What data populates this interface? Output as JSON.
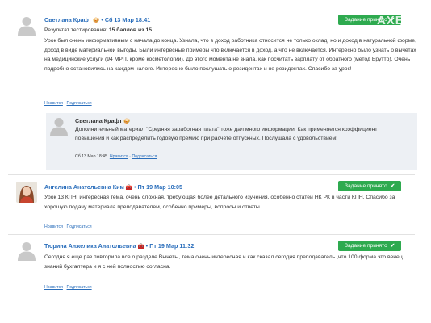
{
  "comments": [
    {
      "author": "Светлана Крафт",
      "author_emoji": "🥪",
      "date": "Сб 13 Мар 18:41",
      "badge": "Задание принято",
      "watermark": "AXEJA",
      "result_prefix": "Результат тестирования: ",
      "result_value": "15 баллов из 15",
      "text": "Урок был очень информативным с начала до конца. Узнала, что в доход работника относится не только оклад, но и доход в натуральной форме, доход в виде материальной выгоды. Были интересные примеры что включается в доход, а что не включается. Интересно было узнать о вычетах на медицинские услуги (94 МРП, кроме косметологии). До этого момента не знала, как посчитать зарплату от обратного (метод Брутто). Очень подробно остановились на каждом налоге. Интересно было послушать о резидентах и не резидентах. Спасибо за урок!",
      "like": "Нравится",
      "subscribe": "Подписаться",
      "reply": {
        "author": "Светлана Крафт",
        "author_emoji": "🥪",
        "text": "Дополнительный материал \"Средняя заработная плата\" тоже дал много информации. Как применяется коэффициент повышения и как распределить годовую премию при расчете отпускных. Послушала с удовольствием!",
        "date": "Сб 13 Мар 18:45",
        "like": "Нравится",
        "subscribe": "Подписаться"
      }
    },
    {
      "author": "Ангелина Анатольевна Ким",
      "author_emoji": "🧰",
      "date": "Пт 19 Мар 10:05",
      "badge": "Задание принято",
      "text": "Урок 13 КПН, интересная тема, очень сложная, требующая более детального изучения, особенно статей НК РК в части КПН. Спасибо за хорошую подачу материала преподавателем, особенно примеры, вопросы и ответы.",
      "like": "Нравится",
      "subscribe": "Подписаться"
    },
    {
      "author": "Тюрина Анжелика Анатольевна",
      "author_emoji": "🧰",
      "date": "Пт 19 Мар 11:32",
      "badge": "Задание принято",
      "text": "Сегодня я еще раз повторила все о разделе Вычеты, тема очень интересная и как сказал сегодня преподаватель ,что 100 форма это венец знаний бухгалтера и я с ней полностью согласна.",
      "like": "Нравится",
      "subscribe": "Подписаться"
    }
  ],
  "colors": {
    "link": "#2a6ebb",
    "badge": "#2eaa4f",
    "reply_bg": "#edf0f4"
  },
  "icons": {
    "check": "✔",
    "avatar": "default-user-avatar"
  },
  "separator": " • ",
  "links_separator": " · "
}
